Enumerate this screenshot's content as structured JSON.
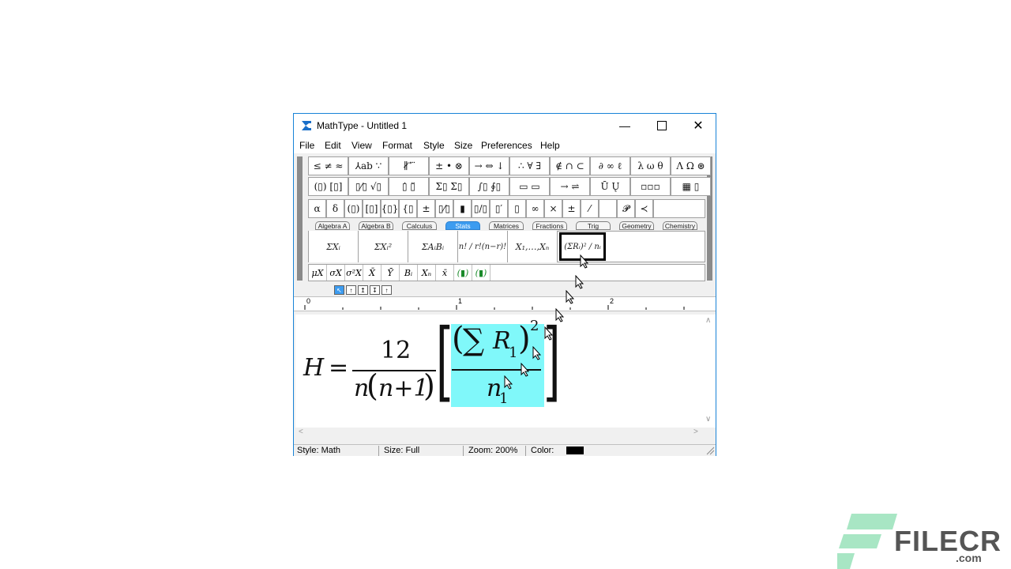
{
  "window": {
    "title": "MathType - Untitled 1"
  },
  "menu": [
    "File",
    "Edit",
    "View",
    "Format",
    "Style",
    "Size",
    "Preferences",
    "Help"
  ],
  "palette": {
    "row1": [
      "≤ ≠ ≈",
      "⅄ab ∵",
      "∦ ⃗ ⃛",
      "± • ⊗",
      "→ ⇔ ↓",
      "∴ ∀ ∃",
      "∉ ∩ ⊂",
      "∂ ∞ ℓ",
      "λ ω θ",
      "Λ Ω ⊛"
    ],
    "row2": [
      "(▯) [▯]",
      "▯⁄▯ √▯",
      "▯̇ ▯̈",
      "Σ▯ Σ▯",
      "∫▯ ∮▯",
      "▭ ▭",
      "→ ⇌",
      "Ū Ų",
      "▫▫▫",
      "▦ ▯"
    ],
    "row3": [
      "α",
      "δ",
      "(▯)",
      "[▯]",
      "{▯}",
      "{▯",
      "±",
      "▯⁄▯",
      "▮",
      "▯/▯",
      "▯′",
      "▯",
      "∞",
      "×",
      "±",
      "⁄",
      "",
      "𝓟",
      "≺"
    ],
    "tabs": [
      "Algebra A",
      "Algebra B",
      "Calculus",
      "Stats",
      "Matrices",
      "Fractions",
      "Trig",
      "Geometry",
      "Chemistry"
    ],
    "templates": [
      "ΣXᵢ",
      "ΣXᵢ²",
      "ΣAᵢBᵢ",
      "n! / r!(n−r)!",
      "X₁,…,Xₙ",
      "(ΣRᵢ)² / nᵢ"
    ],
    "small_row": [
      "μX",
      "σX",
      "σ²X",
      "X̄",
      "Ȳ",
      "Bᵢ",
      "Xₙ",
      "x̄",
      "(▮)",
      "(▮)"
    ],
    "mini_toolbar": [
      "↖",
      "↑",
      "↥",
      "↧",
      "↑"
    ],
    "ruler": [
      "0",
      "1",
      "2"
    ]
  },
  "equation": {
    "lhs": "H",
    "eq": "=",
    "num": "12",
    "den_n": "n",
    "den_open": "(",
    "den_inner": "n+1",
    "den_close": ")",
    "bracket_l": "[",
    "bracket_r": "]",
    "paren_l": "(",
    "sigma": "∑",
    "R": "R",
    "R_sub": "1",
    "paren_r": ")",
    "exp": "2",
    "n": "n",
    "n_sub": "1"
  },
  "status": {
    "style": "Style: Math",
    "size": "Size: Full",
    "zoom": "Zoom: 200%",
    "color": "Color:"
  },
  "watermark": {
    "brand": "FILECR",
    "sub": ".com"
  },
  "colors": {
    "accent": "#1883d7",
    "selection": "#80f8fa",
    "tab_active": "#3d9cf0"
  }
}
